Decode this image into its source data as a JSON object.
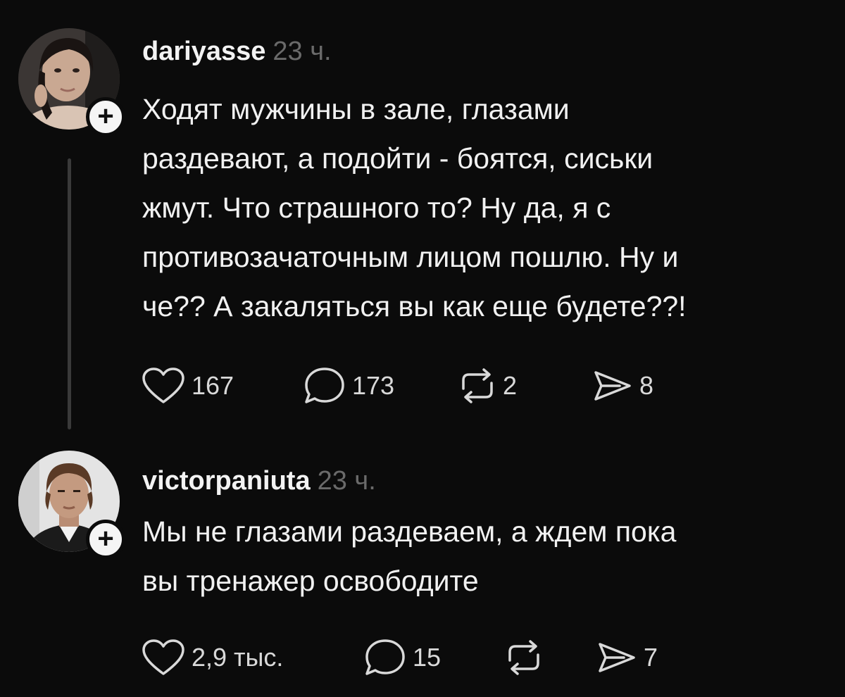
{
  "posts": [
    {
      "username": "dariyasse",
      "time": "23 ч.",
      "text": "Ходят мужчины в зале, глазами\nраздевают, а подойти - боятся, сиськи\nжмут. Что страшного то? Ну да, я с\nпротивозачаточным лицом пошлю. Ну и\nче?? А закаляться вы как еще будете??!",
      "likes": "167",
      "comments": "173",
      "reposts": "2",
      "shares": "8",
      "follow_symbol": "+"
    },
    {
      "username": "victorpaniuta",
      "time": "23 ч.",
      "text": "Мы не глазами раздеваем, а ждем пока\nвы тренажер освободите",
      "likes": "2,9 тыс.",
      "comments": "15",
      "shares": "7",
      "follow_symbol": "+"
    }
  ],
  "icons": {
    "like": "heart-icon",
    "comment": "speech-bubble-icon",
    "repost": "repost-arrows-icon",
    "share": "send-icon",
    "follow": "plus-icon"
  },
  "colors": {
    "background": "#0b0b0b",
    "text": "#f1f1f1",
    "muted": "#6a6a6a",
    "thread_line": "#3a3a3a"
  }
}
